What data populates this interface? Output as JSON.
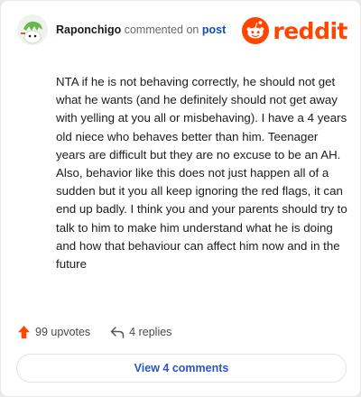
{
  "comment": {
    "username": "Raponchigo",
    "action_text": "commented on",
    "post_link": "post",
    "text": "NTA if he is not behaving correctly, he should not get what he wants (and he definitely should not get away with yelling at you all or misbehaving). I have a 4 years old niece who behaves better than him. Teenager years are difficult but they are no excuse to be an AH. Also, behavior like this does not just happen all of a sudden but it you all keep ignoring the red flags, it can end up badly. I think you and your parents should try to talk to him to make him understand what he is doing and how that behaviour can affect him now and in the future"
  },
  "brand": {
    "name": "reddit",
    "color": "#ff4500"
  },
  "actions": {
    "upvotes": "99 upvotes",
    "replies": "4 replies"
  },
  "footer": {
    "view_comments": "View 4 comments"
  },
  "icons": [
    "avatar",
    "reddit-snoo-icon",
    "upvote-arrow-icon",
    "reply-arrow-icon"
  ],
  "colors": {
    "accent": "#ff4500",
    "link": "#0b4db8",
    "button_text": "#2a56c6"
  }
}
